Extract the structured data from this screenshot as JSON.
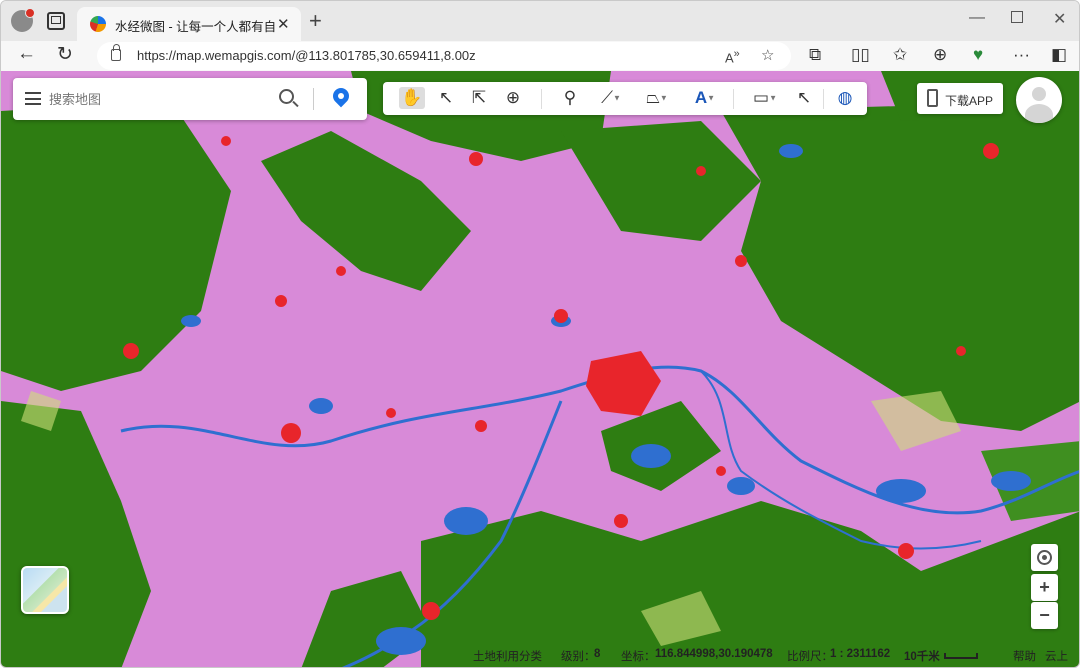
{
  "browser": {
    "tab_title": "水经微图 - 让每一个人都有自己的",
    "url": "https://map.wemapgis.com/@113.801785,30.659411,8.00z"
  },
  "map_ui": {
    "search_placeholder": "搜索地图",
    "download_app_label": "下载APP",
    "zoom_in_label": "+",
    "zoom_out_label": "−"
  },
  "statusbar": {
    "layer_name": "土地利用分类",
    "level_label": "级别：",
    "level_value": "8",
    "coord_label": "坐标：",
    "coord_value": "116.844998,30.190478",
    "scale_label": "比例尺：",
    "scale_value": "1 : 2311162",
    "scale_distance": "10千米",
    "help_label": "帮助",
    "cloud_label": "云上"
  },
  "colors": {
    "cropland": "#d88ad8",
    "forest": "#2e7d12",
    "urban": "#e8252b",
    "water": "#2f6fd0",
    "grassland": "#cfe07a"
  }
}
